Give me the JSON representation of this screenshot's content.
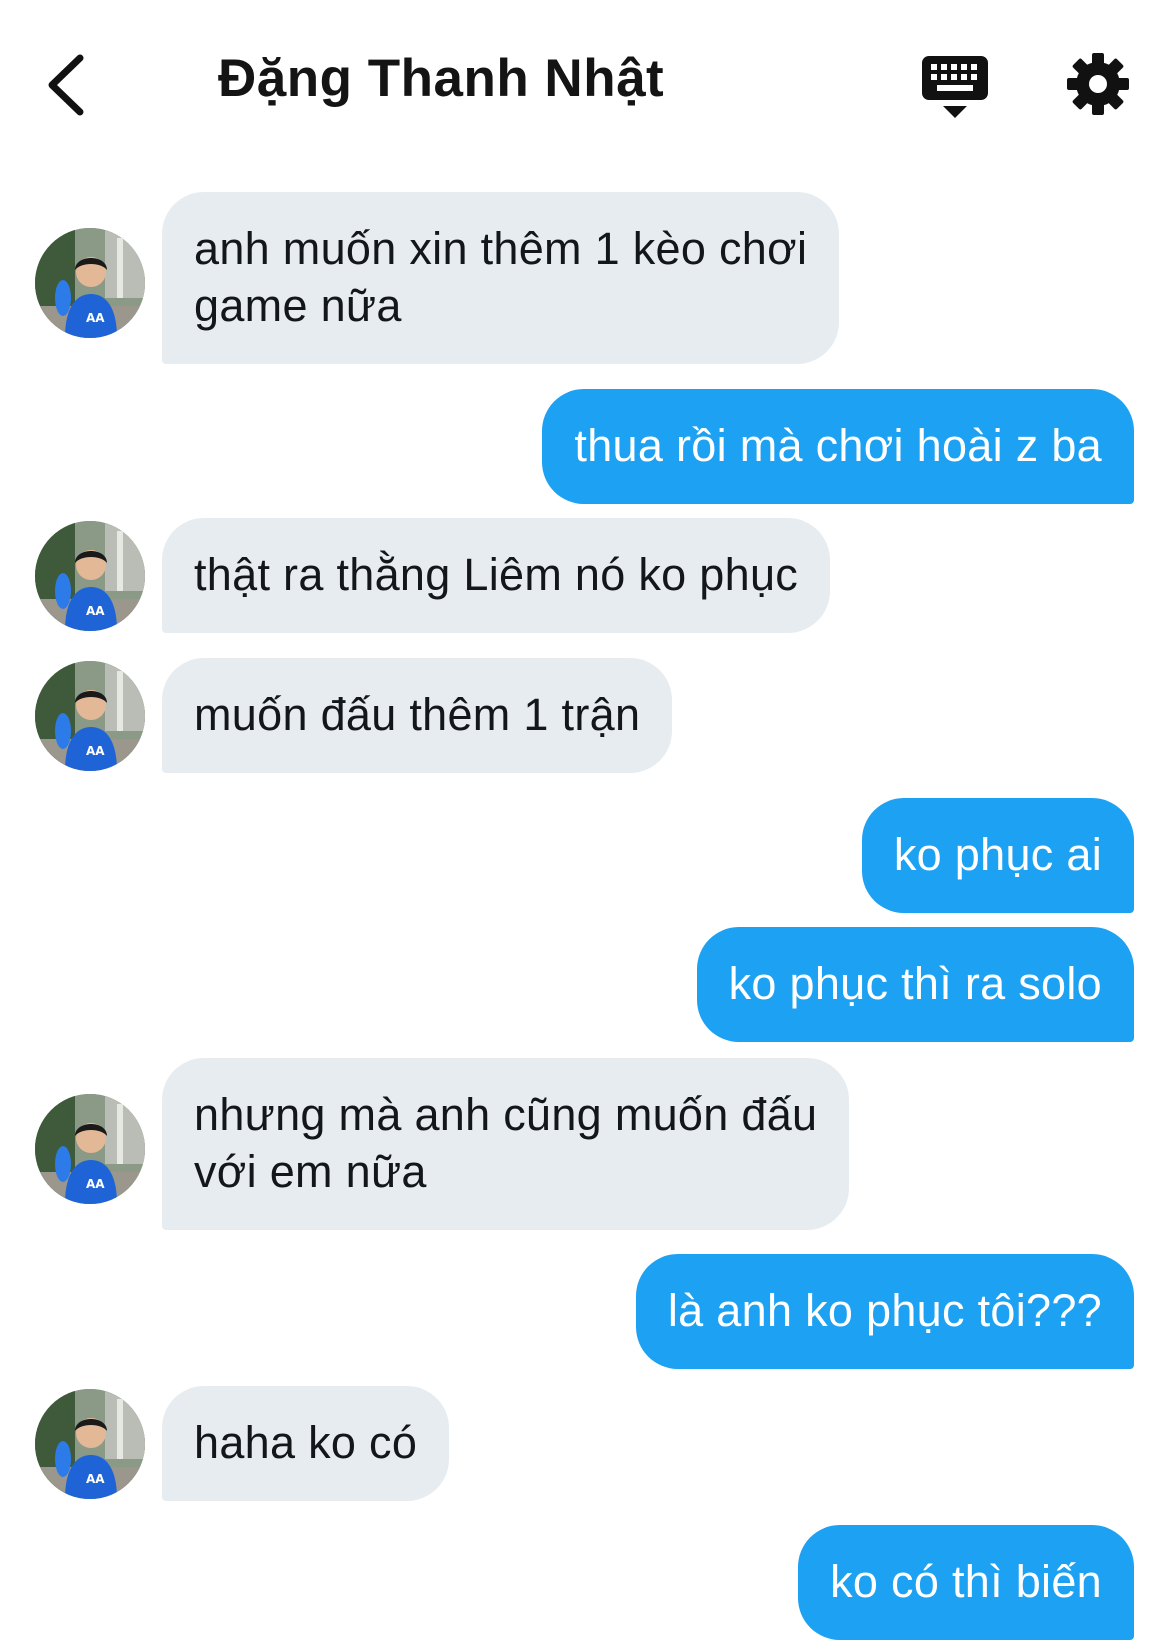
{
  "header": {
    "title": "Đặng Thanh Nhật",
    "back_icon": "chevron-left-icon",
    "keyboard_icon": "keyboard-icon",
    "settings_icon": "gear-icon"
  },
  "colors": {
    "incoming_bubble": "#e6ecf0",
    "outgoing_bubble": "#1da1f2",
    "incoming_text": "#14171a",
    "outgoing_text": "#ffffff"
  },
  "messages": [
    {
      "sender": "them",
      "lines": [
        "anh muốn xin thêm 1 kèo chơi",
        "game nữa"
      ]
    },
    {
      "sender": "me",
      "lines": [
        "thua rồi mà chơi hoài z ba"
      ]
    },
    {
      "sender": "them",
      "lines": [
        "thật ra thằng Liêm nó ko phục"
      ]
    },
    {
      "sender": "them",
      "lines": [
        "muốn đấu thêm 1 trận"
      ]
    },
    {
      "sender": "me",
      "lines": [
        "ko phục ai"
      ]
    },
    {
      "sender": "me",
      "lines": [
        "ko phục thì ra solo"
      ]
    },
    {
      "sender": "them",
      "lines": [
        "nhưng mà anh cũng muốn đấu",
        "với em nữa"
      ]
    },
    {
      "sender": "me",
      "lines": [
        "là anh ko phục tôi???"
      ]
    },
    {
      "sender": "them",
      "lines": [
        "haha ko có"
      ]
    },
    {
      "sender": "me",
      "lines": [
        "ko có thì biến"
      ]
    }
  ]
}
